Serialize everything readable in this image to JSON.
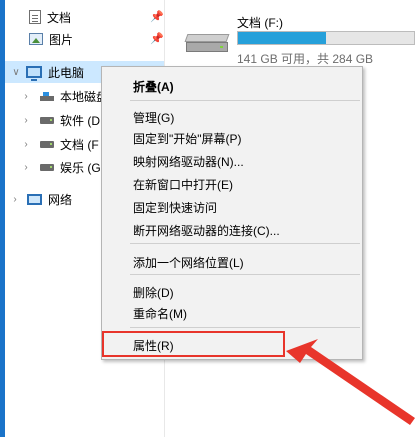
{
  "nav": {
    "quick": [
      {
        "label": "文档",
        "icon": "document-icon",
        "pin": "pin-icon"
      },
      {
        "label": "图片",
        "icon": "picture-icon",
        "pin": "pin-icon"
      }
    ],
    "this_pc": {
      "label": "此电脑",
      "icon": "this-pc-icon",
      "chevron": "chevron-down-icon"
    },
    "drives": [
      {
        "label": "本地磁盘",
        "icon": "windows-drive-icon"
      },
      {
        "label": "软件 (D",
        "icon": "drive-icon"
      },
      {
        "label": "文档 (F",
        "icon": "drive-icon"
      },
      {
        "label": "娱乐 (G",
        "icon": "drive-icon"
      }
    ],
    "network": {
      "label": "网络",
      "icon": "network-icon"
    }
  },
  "drive_tile": {
    "label": "文档 (F:)",
    "space": "141 GB 可用，共 284 GB",
    "used_fraction": 0.5,
    "bar_color": "#26a0da"
  },
  "context_menu": {
    "items": [
      {
        "label": "折叠(A)",
        "default": true
      },
      {
        "label": "管理(G)"
      },
      {
        "label": "固定到\"开始\"屏幕(P)"
      },
      {
        "label": "映射网络驱动器(N)..."
      },
      {
        "label": "在新窗口中打开(E)"
      },
      {
        "label": "固定到快速访问"
      },
      {
        "label": "断开网络驱动器的连接(C)..."
      },
      {
        "label": "添加一个网络位置(L)"
      },
      {
        "label": "删除(D)"
      },
      {
        "label": "重命名(M)"
      },
      {
        "label": "属性(R)"
      }
    ],
    "highlighted": "属性(R)"
  },
  "colors": {
    "accent": "#1a73c9",
    "selection": "#cce8ff",
    "annotation": "#e8352b"
  }
}
